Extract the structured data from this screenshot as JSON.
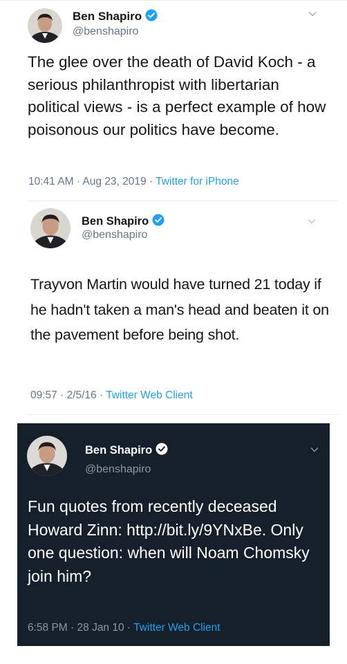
{
  "colors": {
    "link_blue": "#1da1f2",
    "verified_blue": "#1da1f2",
    "dark_background": "#15202b",
    "secondary_text": "#657786"
  },
  "tweets": [
    {
      "author_name": "Ben Shapiro",
      "handle": "@benshapiro",
      "verified_icon": "verified-badge-icon",
      "text": "The glee over the death of David Koch - a serious philanthropist with libertarian political views - is a perfect example of how poisonous our politics have become.",
      "time": "10:41 AM",
      "date": "Aug 23, 2019",
      "source": "Twitter for iPhone",
      "separator": " · "
    },
    {
      "author_name": "Ben Shapiro",
      "handle": "@benshapiro",
      "verified_icon": "verified-badge-icon",
      "text": "Trayvon Martin would have turned 21 today if he hadn't taken a man's head and beaten it on the pavement before being shot.",
      "time": "09:57",
      "date": "2/5/16",
      "source": "Twitter Web Client",
      "separator": " · "
    },
    {
      "author_name": "Ben Shapiro",
      "handle": "@benshapiro",
      "verified_icon": "verified-badge-icon",
      "text": "Fun quotes from recently deceased Howard Zinn: http://bit.ly/9YNxBe.  Only one question: when will Noam Chomsky join him?",
      "time": "6:58 PM",
      "date": "28 Jan 10",
      "source": "Twitter Web Client",
      "separator": " · "
    }
  ]
}
